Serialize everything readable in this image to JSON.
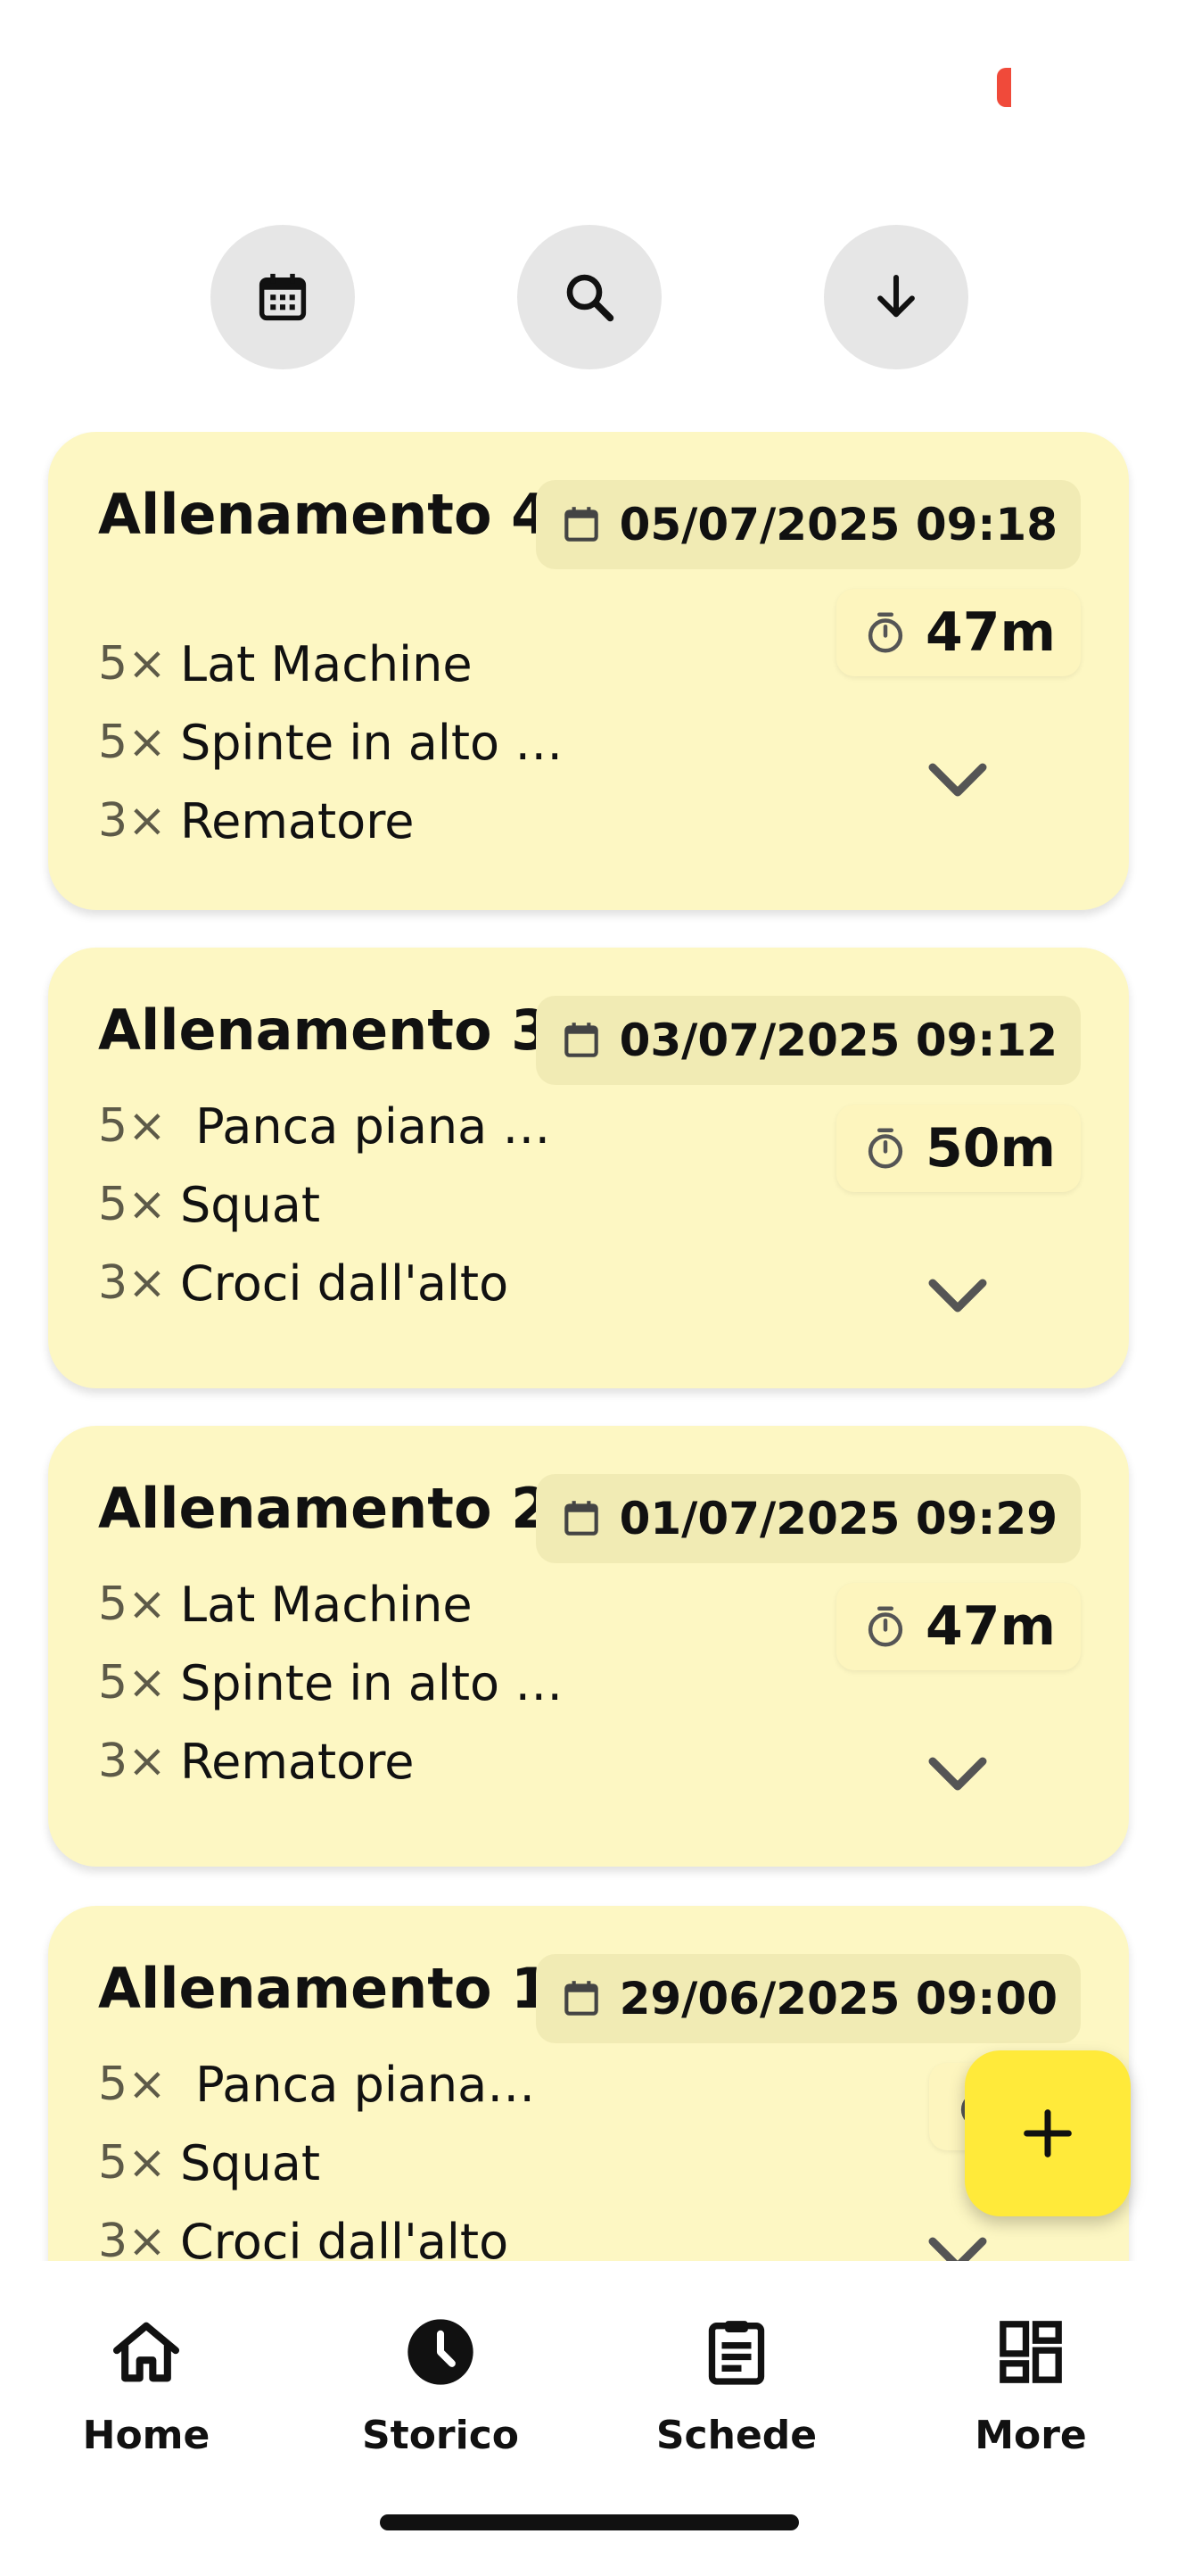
{
  "toolbar": {
    "calendar_icon": "calendar-icon",
    "search_icon": "search-icon",
    "sort_icon": "arrow-down-icon"
  },
  "workouts": [
    {
      "title": "Allenamento 4",
      "date": "05/07/2025 09:18",
      "duration": "47m",
      "exercises": [
        {
          "count": "5×",
          "name": "Lat Machine"
        },
        {
          "count": "5×",
          "name": "Spinte in alto …"
        },
        {
          "count": "3×",
          "name": "Rematore"
        }
      ]
    },
    {
      "title": "Allenamento 3",
      "date": "03/07/2025 09:12",
      "duration": "50m",
      "exercises": [
        {
          "count": "5×",
          "name": " Panca piana …"
        },
        {
          "count": "5×",
          "name": "Squat"
        },
        {
          "count": "3×",
          "name": "Croci dall'alto"
        }
      ]
    },
    {
      "title": "Allenamento 2",
      "date": "01/07/2025 09:29",
      "duration": "47m",
      "exercises": [
        {
          "count": "5×",
          "name": "Lat Machine"
        },
        {
          "count": "5×",
          "name": "Spinte in alto …"
        },
        {
          "count": "3×",
          "name": "Rematore"
        }
      ]
    },
    {
      "title": "Allenamento 1",
      "date": "29/06/2025 09:00",
      "duration": "5",
      "exercises": [
        {
          "count": "5×",
          "name": " Panca piana…"
        },
        {
          "count": "5×",
          "name": "Squat"
        },
        {
          "count": "3×",
          "name": "Croci dall'alto"
        }
      ]
    }
  ],
  "fab": {
    "icon": "plus-icon"
  },
  "nav": {
    "items": [
      {
        "label": "Home",
        "icon": "home-icon"
      },
      {
        "label": "Storico",
        "icon": "clock-icon",
        "active": true
      },
      {
        "label": "Schede",
        "icon": "clipboard-icon"
      },
      {
        "label": "More",
        "icon": "grid-icon"
      }
    ]
  },
  "colors": {
    "card_bg": "#fdf7c3",
    "date_chip_bg": "#f1ebb4",
    "fab_bg": "#ffea3a",
    "toolbar_btn_bg": "#e6e6e6",
    "status_indicator": "#f04a3a"
  }
}
